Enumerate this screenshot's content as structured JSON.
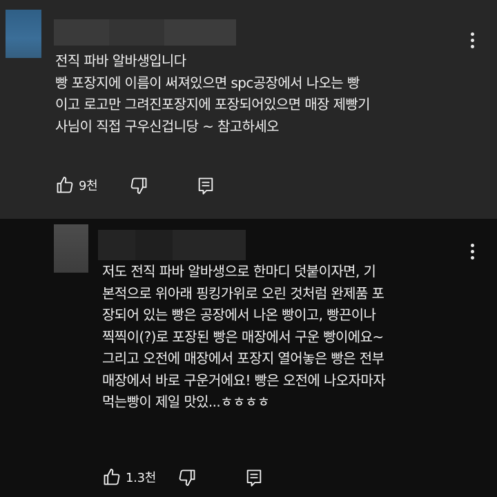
{
  "comments": [
    {
      "lines": [
        "전직 파바 알바생입니다",
        "빵 포장지에  이름이 써져있으면 spc공장에서 나오는 빵",
        "이고 로고만 그려진포장지에 포장되어있으면 매장 제빵기",
        "사님이 직접 구우신겁니당 ~ 참고하세오"
      ],
      "likes": "9천",
      "like_icon": "thumbs-up-icon",
      "dislike_icon": "thumbs-down-icon",
      "reply_icon": "comment-reply-icon",
      "more_icon": "more-vertical-icon"
    },
    {
      "lines": [
        "저도 전직 파바 알바생으로 한마디 덧붙이자면, 기",
        "본적으로 위아래 핑킹가위로 오린 것처럼 완제품 포",
        "장되어 있는 빵은 공장에서 나온 빵이고, 빵끈이나",
        "찍찍이(?)로 포장된 빵은 매장에서 구운 빵이에요~",
        "그리고 오전에 매장에서 포장지 열어놓은 빵은 전부",
        "매장에서 바로 구운거에요! 빵은 오전에 나오자마자",
        "먹는빵이 제일 맛있...ㅎㅎㅎㅎ"
      ],
      "likes": "1.3천",
      "like_icon": "thumbs-up-icon",
      "dislike_icon": "thumbs-down-icon",
      "reply_icon": "comment-reply-icon",
      "more_icon": "more-vertical-icon"
    }
  ],
  "colors": {
    "top_comment_bg": "#272727",
    "reply_bg": "#0f0f0f",
    "text": "#f1f1f1"
  }
}
